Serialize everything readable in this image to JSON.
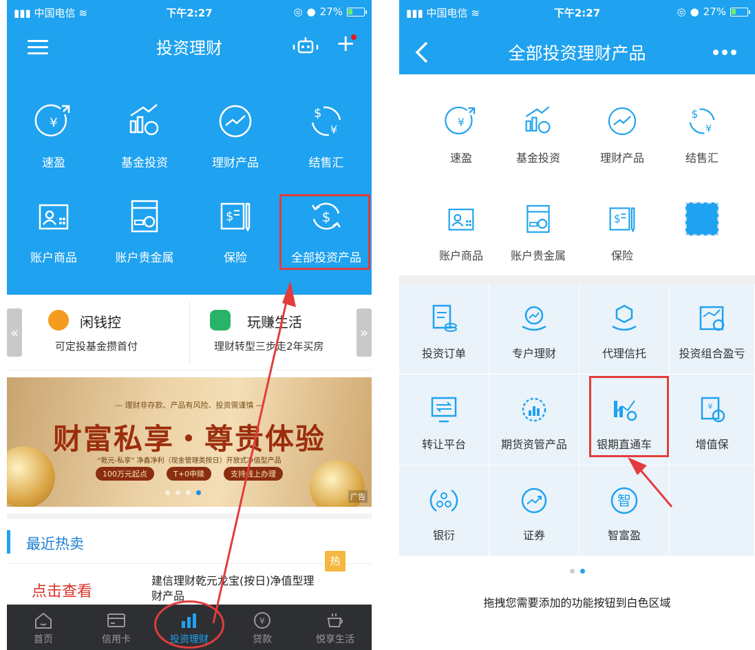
{
  "left": {
    "status": {
      "carrier": "中国电信",
      "time": "下午2:27",
      "battery": "27%",
      "battery_level": 0.27
    },
    "title": "投资理财",
    "grid": [
      {
        "label": "速盈",
        "icon": "yuan-speed-icon"
      },
      {
        "label": "基金投资",
        "icon": "fund-chart-icon"
      },
      {
        "label": "理财产品",
        "icon": "trend-circle-icon"
      },
      {
        "label": "结售汇",
        "icon": "exchange-icon"
      },
      {
        "label": "账户商品",
        "icon": "account-goods-icon"
      },
      {
        "label": "账户贵金属",
        "icon": "precious-metal-icon"
      },
      {
        "label": "保险",
        "icon": "insurance-icon"
      },
      {
        "label": "全部投资产品",
        "icon": "dollar-refresh-icon"
      }
    ],
    "promo": [
      {
        "name": "闲钱控",
        "desc": "可定投基金攒首付",
        "color": "#f59b1f"
      },
      {
        "name": "玩赚生活",
        "desc": "理财转型三步走2年买房",
        "color": "#29b36a"
      }
    ],
    "banner": {
      "line1": "— 理财非存款、产品有风险、投资需谨慎 —",
      "headline": "财富私享・尊贵体验",
      "line2": "“乾元-私享” 净鑫净利（现金管理类按日）开放式净值型产品",
      "tags": [
        "100万元起点",
        "T+0申赎",
        "支持线上办理"
      ],
      "ad": "广告"
    },
    "hot_title": "最近热卖",
    "product": {
      "cta": "点击查看",
      "name": "建信理财乾元龙宝(按日)净值型理财产品",
      "badge": "热"
    },
    "tabs": [
      {
        "label": "首页",
        "icon": "home-icon"
      },
      {
        "label": "信用卡",
        "icon": "credit-card-icon"
      },
      {
        "label": "投资理财",
        "icon": "bar-chart-icon"
      },
      {
        "label": "贷款",
        "icon": "yuan-coin-icon"
      },
      {
        "label": "悦享生活",
        "icon": "coffee-cup-icon"
      }
    ]
  },
  "right": {
    "status": {
      "carrier": "中国电信",
      "time": "下午2:27",
      "battery": "27%",
      "battery_level": 0.27
    },
    "title": "全部投资理财产品",
    "grid": [
      {
        "label": "速盈",
        "icon": "yuan-speed-icon"
      },
      {
        "label": "基金投资",
        "icon": "fund-chart-icon"
      },
      {
        "label": "理财产品",
        "icon": "trend-circle-icon"
      },
      {
        "label": "结售汇",
        "icon": "exchange-icon"
      },
      {
        "label": "账户商品",
        "icon": "account-goods-icon"
      },
      {
        "label": "账户贵金属",
        "icon": "precious-metal-icon"
      },
      {
        "label": "保险",
        "icon": "insurance-icon"
      }
    ],
    "cells": [
      {
        "label": "投资订单",
        "icon": "order-icon"
      },
      {
        "label": "专户理财",
        "icon": "special-account-icon"
      },
      {
        "label": "代理信托",
        "icon": "trust-icon"
      },
      {
        "label": "投资组合盈亏",
        "icon": "portfolio-icon"
      },
      {
        "label": "转让平台",
        "icon": "transfer-screen-icon"
      },
      {
        "label": "期货资管产品",
        "icon": "futures-icon"
      },
      {
        "label": "银期直通车",
        "icon": "bank-futures-icon"
      },
      {
        "label": "增值保",
        "icon": "value-protect-icon"
      },
      {
        "label": "银衍",
        "icon": "bank-derivative-icon"
      },
      {
        "label": "证券",
        "icon": "securities-icon"
      },
      {
        "label": "智富盈",
        "icon": "zhi-icon"
      }
    ],
    "zhi_char": "智",
    "hint": "拖拽您需要添加的功能按钮到白色区域"
  },
  "colors": {
    "primary": "#1fa2ef",
    "highlight": "#e23c3c",
    "tabbar": "#2e2f33"
  }
}
